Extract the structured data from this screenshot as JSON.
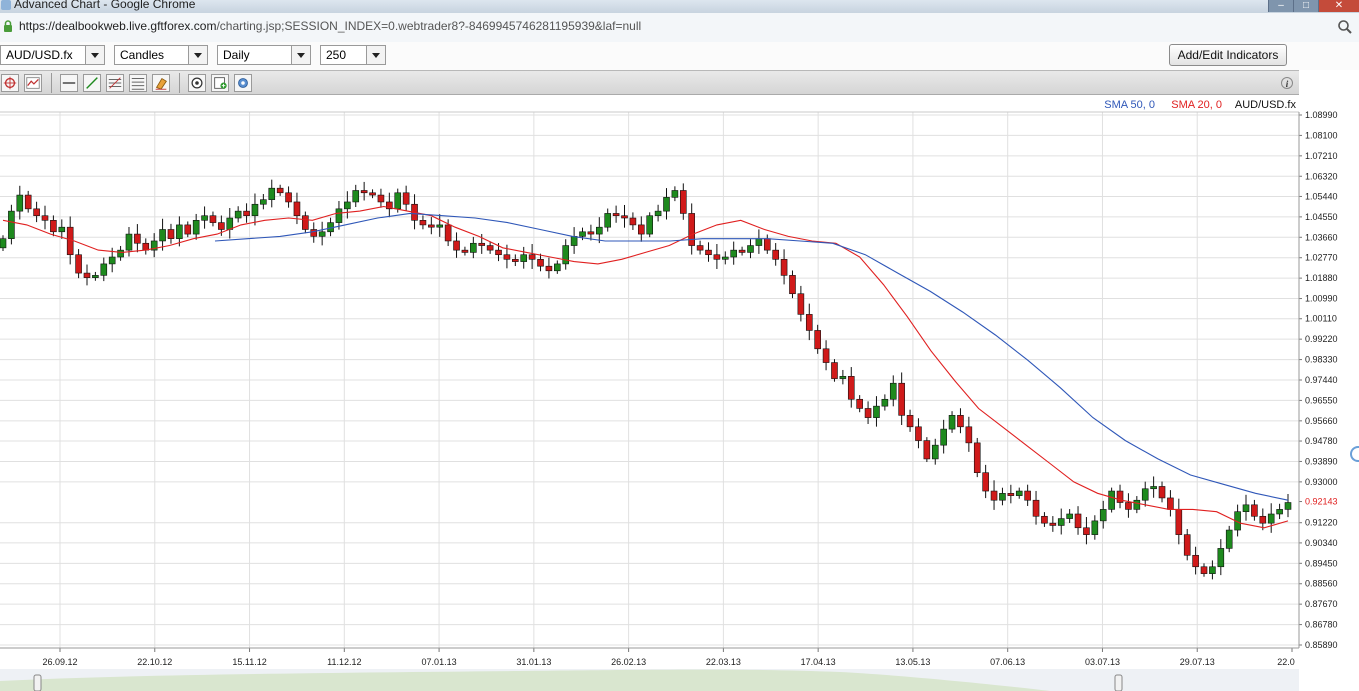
{
  "window": {
    "title": "Advanced Chart - Google Chrome"
  },
  "address": {
    "host": "https://dealbookweb.live.gftforex.com",
    "path": "/charting.jsp;SESSION_INDEX=0.webtrader8?-8469945746281195939&laf=null"
  },
  "toolbar": {
    "symbol": "AUD/USD.fx",
    "chart_type": "Candles",
    "interval": "Daily",
    "bars": "250",
    "indicators_button": "Add/Edit Indicators"
  },
  "legend": {
    "sma50": "SMA 50, 0",
    "sma20": "SMA 20, 0",
    "symbol": "AUD/USD.fx"
  },
  "colors": {
    "sma50": "#2f57b8",
    "sma20": "#e02020",
    "up": "#1e8a1e",
    "down": "#d01a1a",
    "grid": "#e0e0e0"
  },
  "chart_data": {
    "type": "candlestick",
    "symbol": "AUD/USD.fx",
    "current_price": "0.92143",
    "y_ticks": [
      "1.08990",
      "1.08100",
      "1.07210",
      "1.06320",
      "1.05440",
      "1.04550",
      "1.03660",
      "1.02770",
      "1.01880",
      "1.00990",
      "1.00110",
      "0.99220",
      "0.98330",
      "0.97440",
      "0.96550",
      "0.95660",
      "0.94780",
      "0.93890",
      "0.93000",
      "0.92143",
      "0.91220",
      "0.90340",
      "0.89450",
      "0.88560",
      "0.87670",
      "0.86780",
      "0.85890"
    ],
    "ylim": [
      0.8589,
      1.0899
    ],
    "x_ticks": [
      "26.09.12",
      "22.10.12",
      "15.11.12",
      "11.12.12",
      "07.01.13",
      "31.01.13",
      "26.02.13",
      "22.03.13",
      "17.04.13",
      "13.05.13",
      "07.06.13",
      "03.07.13",
      "29.07.13",
      "22.0"
    ],
    "series": [
      {
        "name": "AUD/USD.fx",
        "kind": "close",
        "values": [
          1.036,
          1.048,
          1.055,
          1.049,
          1.046,
          1.044,
          1.039,
          1.041,
          1.029,
          1.021,
          1.019,
          1.02,
          1.025,
          1.028,
          1.031,
          1.038,
          1.034,
          1.031,
          1.035,
          1.04,
          1.036,
          1.042,
          1.038,
          1.044,
          1.046,
          1.043,
          1.04,
          1.045,
          1.048,
          1.046,
          1.051,
          1.053,
          1.058,
          1.056,
          1.052,
          1.046,
          1.04,
          1.037,
          1.039,
          1.043,
          1.049,
          1.052,
          1.057,
          1.056,
          1.055,
          1.052,
          1.049,
          1.056,
          1.051,
          1.044,
          1.042,
          1.041,
          1.042,
          1.035,
          1.031,
          1.03,
          1.034,
          1.033,
          1.031,
          1.029,
          1.027,
          1.026,
          1.029,
          1.027,
          1.024,
          1.022,
          1.025,
          1.033,
          1.037,
          1.039,
          1.038,
          1.041,
          1.047,
          1.046,
          1.045,
          1.042,
          1.038,
          1.046,
          1.048,
          1.054,
          1.057,
          1.047,
          1.033,
          1.031,
          1.029,
          1.027,
          1.028,
          1.031,
          1.03,
          1.033,
          1.036,
          1.031,
          1.027,
          1.02,
          1.012,
          1.003,
          0.996,
          0.988,
          0.982,
          0.975,
          0.976,
          0.966,
          0.962,
          0.958,
          0.963,
          0.966,
          0.973,
          0.959,
          0.954,
          0.948,
          0.94,
          0.946,
          0.953,
          0.959,
          0.954,
          0.947,
          0.934,
          0.926,
          0.922,
          0.925,
          0.924,
          0.926,
          0.922,
          0.915,
          0.912,
          0.911,
          0.914,
          0.916,
          0.91,
          0.907,
          0.913,
          0.918,
          0.926,
          0.921,
          0.918,
          0.922,
          0.927,
          0.928,
          0.923,
          0.918,
          0.907,
          0.898,
          0.893,
          0.89,
          0.893,
          0.901,
          0.909,
          0.917,
          0.92,
          0.915,
          0.912,
          0.916,
          0.918,
          0.921
        ]
      },
      {
        "name": "SMA 20, 0",
        "values": [
          1.044,
          1.042,
          1.038,
          1.035,
          1.031,
          1.03,
          1.031,
          1.033,
          1.036,
          1.038,
          1.042,
          1.044,
          1.045,
          1.044,
          1.047,
          1.048,
          1.05,
          1.048,
          1.046,
          1.041,
          1.037,
          1.032,
          1.03,
          1.028,
          1.026,
          1.025,
          1.027,
          1.03,
          1.033,
          1.038,
          1.042,
          1.044,
          1.04,
          1.037,
          1.035,
          1.034,
          1.028,
          1.016,
          1.002,
          0.987,
          0.974,
          0.962,
          0.954,
          0.946,
          0.938,
          0.93,
          0.925,
          0.922,
          0.92,
          0.918,
          0.918,
          0.917,
          0.912,
          0.91,
          0.913
        ]
      },
      {
        "name": "SMA 50, 0",
        "values": [
          1.035,
          1.036,
          1.037,
          1.039,
          1.042,
          1.045,
          1.047,
          1.046,
          1.045,
          1.043,
          1.04,
          1.037,
          1.035,
          1.035,
          1.035,
          1.036,
          1.036,
          1.036,
          1.035,
          1.034,
          1.029,
          1.021,
          1.013,
          1.004,
          0.994,
          0.983,
          0.971,
          0.958,
          0.948,
          0.94,
          0.933,
          0.929,
          0.925,
          0.922
        ]
      }
    ]
  }
}
